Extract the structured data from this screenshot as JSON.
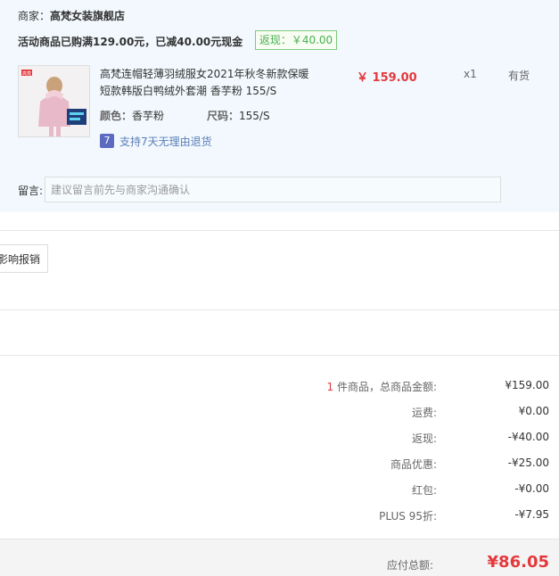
{
  "shop": {
    "label": "商家：",
    "name": "高梵女装旗舰店",
    "promo_text": "活动商品已购满129.00元，已减40.00元现金",
    "rebate_tag": "返现：￥40.00"
  },
  "item": {
    "thumb_badge": "高梵",
    "title_line1": "高梵连帽轻薄羽绒服女2021年秋冬新款保暖",
    "title_line2": "短款韩版白鸭绒外套潮 香芋粉 155/S",
    "price": "￥ 159.00",
    "quantity": "x1",
    "stock": "有货",
    "color_label": "颜色：",
    "color_value": "香芋粉",
    "size_label": "尺码：",
    "size_value": "155/S",
    "return_icon": "7",
    "return_policy": "支持7天无理由退货"
  },
  "message": {
    "label": "留言:",
    "placeholder": "建议留言前先与商家沟通确认"
  },
  "reimburse_button": "影响报销",
  "summary": {
    "count": "1",
    "count_suffix": " 件商品，总商品金额:",
    "rows": [
      {
        "label": "",
        "value": "¥159.00"
      },
      {
        "label": "运费:",
        "value": "¥0.00"
      },
      {
        "label": "返现:",
        "value": "-¥40.00"
      },
      {
        "label": "商品优惠:",
        "value": "-¥25.00"
      },
      {
        "label": "红包:",
        "value": "-¥0.00"
      },
      {
        "label": "PLUS 95折:",
        "value": "-¥7.95"
      }
    ],
    "total_label": "应付总额:",
    "total_value": "¥86.05"
  },
  "colors": {
    "accent_red": "#e4393c",
    "panel_bg": "#f2f8fd",
    "rebate_green": "#4caf50",
    "link_blue": "#5b7fb8"
  }
}
